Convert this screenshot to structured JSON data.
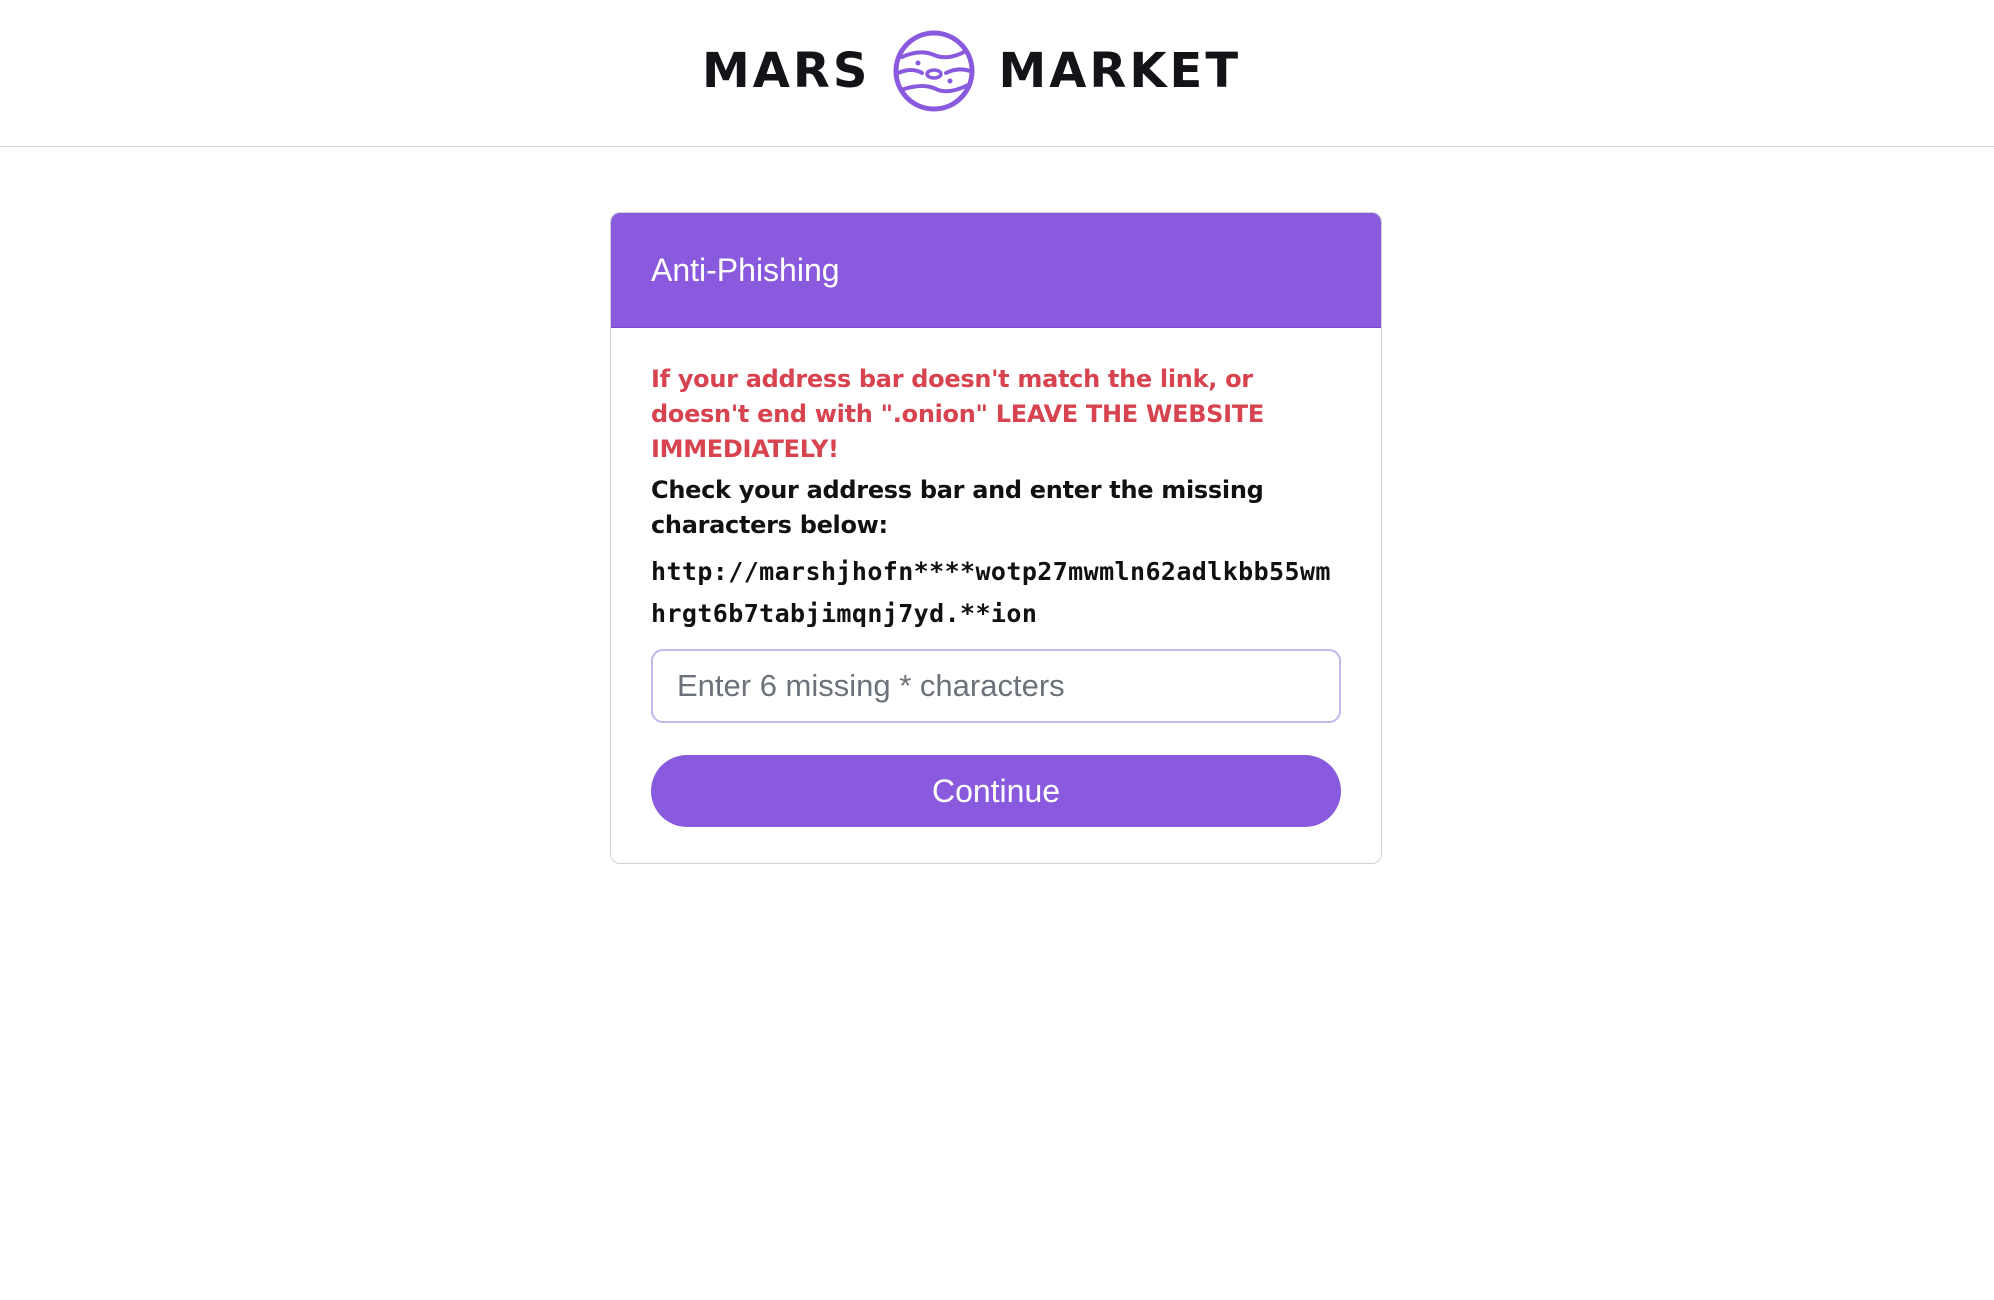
{
  "header": {
    "logo_left": "MARS",
    "logo_right": "MARKET",
    "logo_icon": "planet-icon",
    "accent_color": "#8a5ade"
  },
  "card": {
    "title": "Anti-Phishing",
    "warning": "If your address bar doesn't match the link, or doesn't end with \".onion\" LEAVE THE WEBSITE IMMEDIATELY!",
    "instruction": "Check your address bar and enter the missing characters below:",
    "address": "http://marshjhofn****wotp27mwmln62adlkbb55wmhrgt6b7tabjimqnj7yd.**ion",
    "input": {
      "value": "",
      "placeholder": "Enter 6 missing * characters"
    },
    "continue_label": "Continue",
    "warning_color": "#d7434f"
  }
}
